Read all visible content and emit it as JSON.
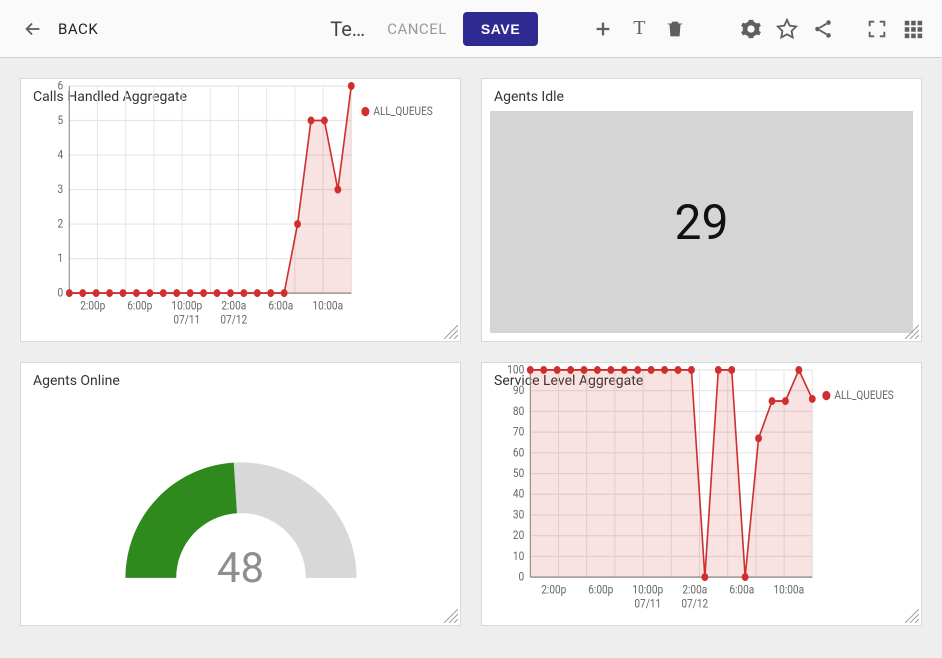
{
  "toolbar": {
    "back_label": "BACK",
    "title_trunc": "Te…",
    "cancel_label": "CANCEL",
    "save_label": "SAVE"
  },
  "cards": {
    "calls": {
      "title": "Calls Handled Aggregate",
      "legend": "ALL_QUEUES"
    },
    "idle": {
      "title": "Agents Idle",
      "value": "29"
    },
    "online": {
      "title": "Agents Online",
      "value": "48"
    },
    "sla": {
      "title": "Service Level Aggregate",
      "legend": "ALL_QUEUES"
    }
  },
  "chart_data": [
    {
      "id": "calls",
      "type": "area",
      "title": "Calls Handled Aggregate",
      "x_ticks": [
        "2:00p",
        "6:00p",
        "10:00p\n07/11",
        "2:00a\n07/12",
        "6:00a",
        "10:00a"
      ],
      "ylim": [
        0,
        6
      ],
      "y_ticks": [
        0,
        1,
        2,
        3,
        4,
        5,
        6
      ],
      "series": [
        {
          "name": "ALL_QUEUES",
          "values": [
            0,
            0,
            0,
            0,
            0,
            0,
            0,
            0,
            0,
            0,
            0,
            0,
            0,
            0,
            0,
            0,
            0,
            2,
            5,
            5,
            3,
            6
          ]
        }
      ]
    },
    {
      "id": "idle",
      "type": "singlestat",
      "title": "Agents Idle",
      "value": 29
    },
    {
      "id": "online",
      "type": "gauge",
      "title": "Agents Online",
      "value": 48,
      "min": 0,
      "max": 100,
      "fill_color": "#2f8a1d"
    },
    {
      "id": "sla",
      "type": "area",
      "title": "Service Level Aggregate",
      "x_ticks": [
        "2:00p",
        "6:00p",
        "10:00p\n07/11",
        "2:00a\n07/12",
        "6:00a",
        "10:00a"
      ],
      "ylim": [
        0,
        100
      ],
      "y_ticks": [
        0,
        10,
        20,
        30,
        40,
        50,
        60,
        70,
        80,
        90,
        100
      ],
      "series": [
        {
          "name": "ALL_QUEUES",
          "values": [
            100,
            100,
            100,
            100,
            100,
            100,
            100,
            100,
            100,
            100,
            100,
            100,
            100,
            0,
            100,
            100,
            0,
            67,
            85,
            85,
            100,
            86
          ]
        }
      ]
    }
  ]
}
